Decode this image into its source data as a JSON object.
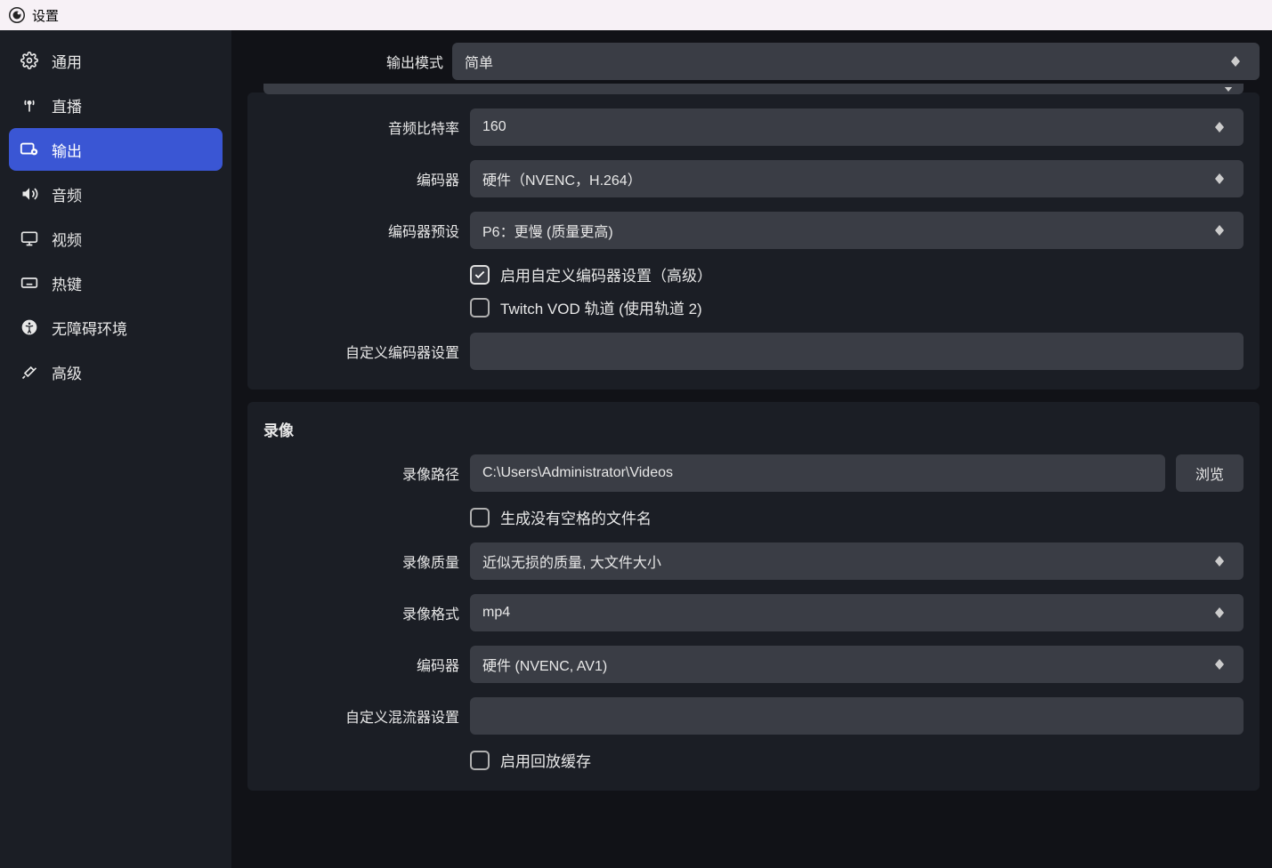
{
  "window": {
    "title": "设置"
  },
  "sidebar": {
    "items": [
      {
        "label": "通用"
      },
      {
        "label": "直播"
      },
      {
        "label": "输出"
      },
      {
        "label": "音频"
      },
      {
        "label": "视频"
      },
      {
        "label": "热键"
      },
      {
        "label": "无障碍环境"
      },
      {
        "label": "高级"
      }
    ],
    "active_index": 2
  },
  "output_mode": {
    "label": "输出模式",
    "value": "简单"
  },
  "streaming": {
    "audio_bitrate": {
      "label": "音频比特率",
      "value": "160"
    },
    "encoder": {
      "label": "编码器",
      "value": "硬件（NVENC，H.264）"
    },
    "encoder_preset": {
      "label": "编码器预设",
      "value": "P6：更慢 (质量更高)"
    },
    "custom_enc_check": {
      "label": "启用自定义编码器设置（高级）",
      "checked": true
    },
    "twitch_vod": {
      "label": "Twitch VOD 轨道 (使用轨道 2)",
      "checked": false
    },
    "custom_enc_settings": {
      "label": "自定义编码器设置",
      "value": ""
    }
  },
  "recording": {
    "section_title": "录像",
    "path": {
      "label": "录像路径",
      "value": "C:\\Users\\Administrator\\Videos",
      "browse": "浏览"
    },
    "no_spaces": {
      "label": "生成没有空格的文件名",
      "checked": false
    },
    "quality": {
      "label": "录像质量",
      "value": "近似无损的质量, 大文件大小"
    },
    "format": {
      "label": "录像格式",
      "value": "mp4"
    },
    "encoder": {
      "label": "编码器",
      "value": "硬件 (NVENC, AV1)"
    },
    "custom_mux": {
      "label": "自定义混流器设置",
      "value": ""
    },
    "replay_buffer": {
      "label": "启用回放缓存",
      "checked": false
    }
  }
}
